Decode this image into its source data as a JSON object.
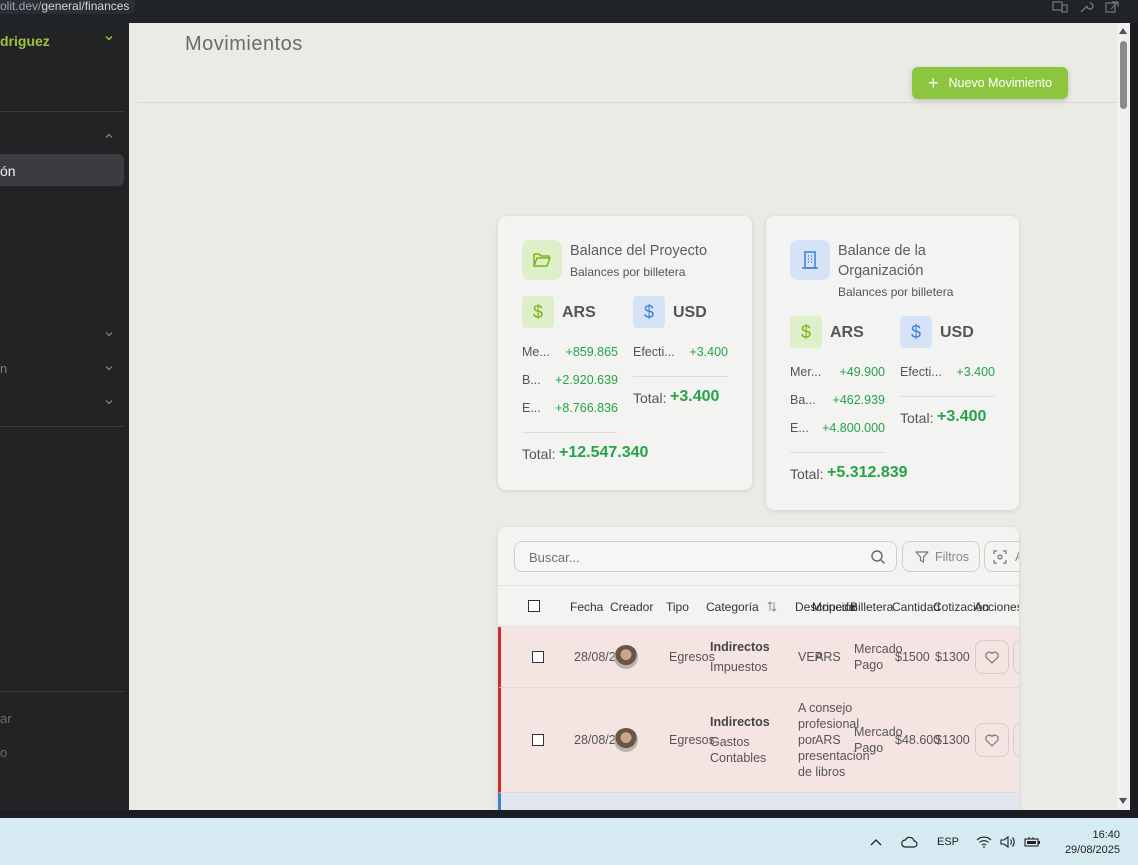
{
  "browser": {
    "url_host": "olit.dev/",
    "url_path": "general/finances"
  },
  "sidebar": {
    "user_name": "driguez",
    "active_item": "ón",
    "bottom_items": [
      "ar",
      "o"
    ]
  },
  "header": {
    "title": "Movimientos",
    "new_button_label": "Nuevo Movimiento"
  },
  "project_balance": {
    "title": "Balance del Proyecto",
    "subtitle": "Balances por billetera",
    "ars": {
      "currency": "ARS",
      "wallets": [
        {
          "name": "Me...",
          "value": "+859.865"
        },
        {
          "name": "B...",
          "value": "+2.920.639"
        },
        {
          "name": "E...",
          "value": "+8.766.836"
        }
      ],
      "total_label": "Total:",
      "total": "+12.547.340"
    },
    "usd": {
      "currency": "USD",
      "wallets": [
        {
          "name": "Efecti...",
          "value": "+3.400"
        }
      ],
      "total_label": "Total:",
      "total": "+3.400"
    }
  },
  "org_balance": {
    "title": "Balance de la Organización",
    "subtitle": "Balances por billetera",
    "ars": {
      "currency": "ARS",
      "wallets": [
        {
          "name": "Mer...",
          "value": "+49.900"
        },
        {
          "name": "Ba...",
          "value": "+462.939"
        },
        {
          "name": "E...",
          "value": "+4.800.000"
        }
      ],
      "total_label": "Total:",
      "total": "+5.312.839"
    },
    "usd": {
      "currency": "USD",
      "wallets": [
        {
          "name": "Efecti...",
          "value": "+3.400"
        }
      ],
      "total_label": "Total:",
      "total": "+3.400"
    }
  },
  "table": {
    "search_placeholder": "Buscar...",
    "filter_label": "Filtros",
    "scan_label": "A",
    "columns": [
      "Fecha",
      "Creador",
      "Tipo",
      "Categoría",
      "Descripción",
      "Moneda",
      "Billetera",
      "Cantidad",
      "Cotización",
      "Acciones"
    ],
    "rows": [
      {
        "date": "28/08/25",
        "type": "Egresos",
        "category": "Indirectos",
        "subcategory": "Impuestos",
        "description": "VEP",
        "currency": "ARS",
        "wallet": "Mercado Pago",
        "amount": "$1500",
        "rate": "$1300"
      },
      {
        "date": "28/08/25",
        "type": "Egresos",
        "category": "Indirectos",
        "subcategory": "Gastos Contables",
        "description": "A consejo profesional por presentacion de libros",
        "currency": "ARS",
        "wallet": "Mercado Pago",
        "amount": "$48.600",
        "rate": "$1300"
      }
    ]
  },
  "taskbar": {
    "language": "ESP",
    "time": "16:40",
    "date": "29/08/2025"
  },
  "colors": {
    "accent_green": "#8cc63f",
    "positive_value": "#27a34a",
    "expense_row": "#f4e4e2",
    "expense_bar": "#d22b2b"
  }
}
